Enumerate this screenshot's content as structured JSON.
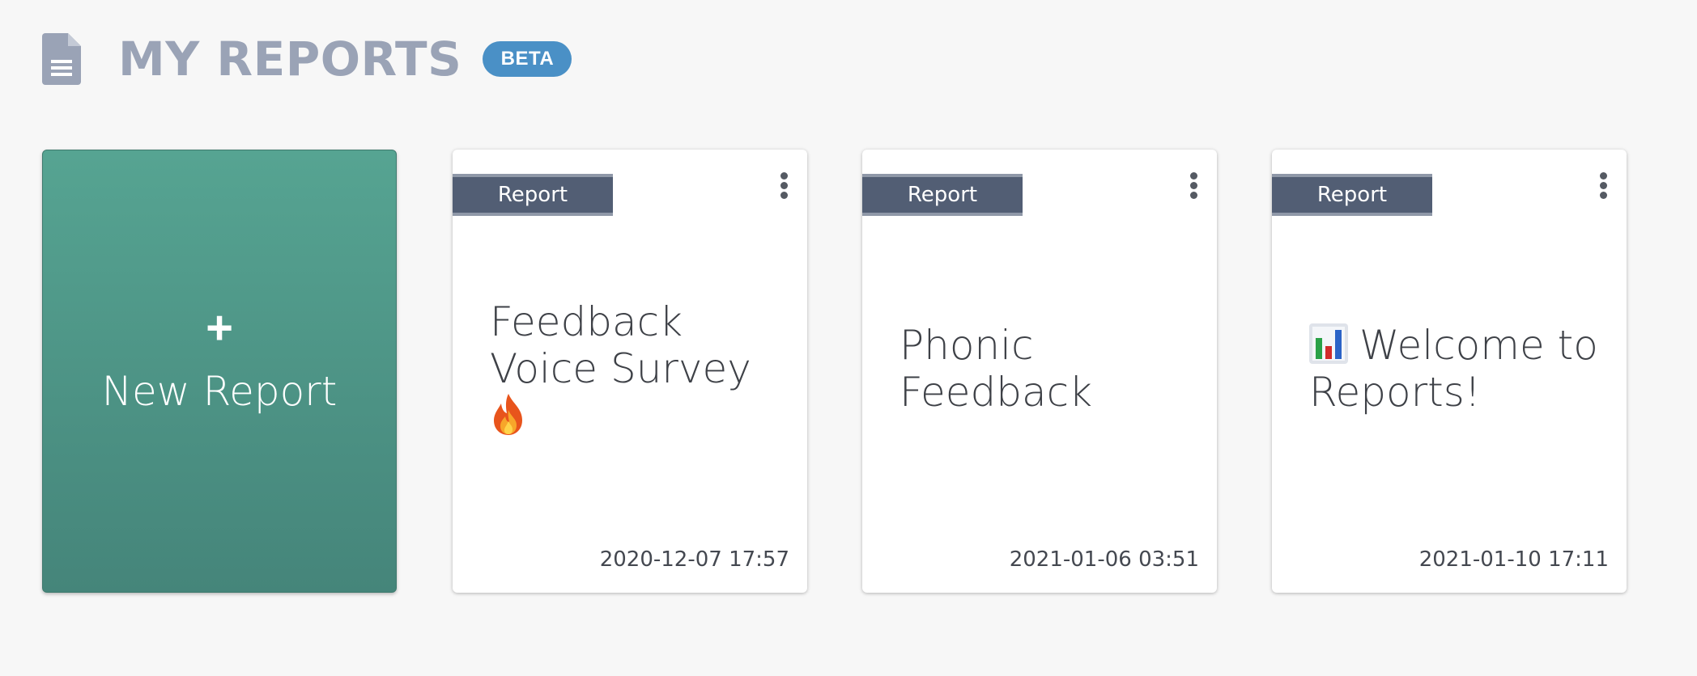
{
  "header": {
    "title": "MY REPORTS",
    "badge": "BETA",
    "icon": "document-icon"
  },
  "new_report": {
    "plus": "+",
    "label": "New Report"
  },
  "reports": [
    {
      "tag": "Report",
      "title": "Feedback Voice Survey",
      "emoji": "fire-icon",
      "date": "2020-12-07 17:57"
    },
    {
      "tag": "Report",
      "title": "Phonic Feedback",
      "date": "2021-01-06 03:51"
    },
    {
      "tag": "Report",
      "title": "Welcome to Reports!",
      "emoji": "bar-chart-icon",
      "date": "2021-01-10 17:11"
    }
  ],
  "colors": {
    "new_card": "#56a492",
    "tag_bg": "#525e74",
    "badge_bg": "#4a90c6",
    "title_gray": "#9aa3b6"
  }
}
